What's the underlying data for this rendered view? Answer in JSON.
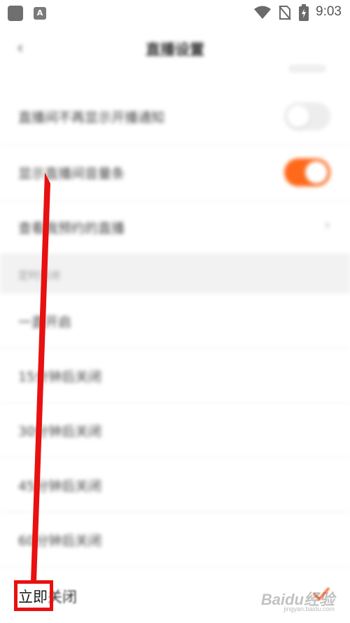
{
  "status_bar": {
    "time": "9:03",
    "icons": [
      "app-icon",
      "app-a-icon",
      "wifi-icon",
      "no-sim-icon",
      "battery-charging-icon"
    ]
  },
  "header": {
    "title": "直播设置",
    "back_icon": "back-chevron-icon"
  },
  "settings": {
    "rows": [
      {
        "label": "直播间不再显示开播通知",
        "control": "toggle",
        "on": false
      },
      {
        "label": "显示直播间音量条",
        "control": "toggle",
        "on": true
      },
      {
        "label": "查看我预约的直播",
        "control": "chevron"
      }
    ],
    "section_title": "定时关闭",
    "timer_options": [
      {
        "label": "一直开启"
      },
      {
        "label": "15分钟后关闭"
      },
      {
        "label": "30分钟后关闭"
      },
      {
        "label": "45分钟后关闭"
      },
      {
        "label": "60分钟后关闭"
      }
    ],
    "last_option": {
      "label_a": "立即",
      "label_b": "关闭",
      "selected": true
    }
  },
  "colors": {
    "toggle_on": "#ff6a1a",
    "toggle_off": "#ededed",
    "annotation_red": "#e81010",
    "check": "#ff5a1f"
  },
  "watermark": {
    "text": "Baidu经验",
    "sub": "jingyan.baidu.com"
  }
}
